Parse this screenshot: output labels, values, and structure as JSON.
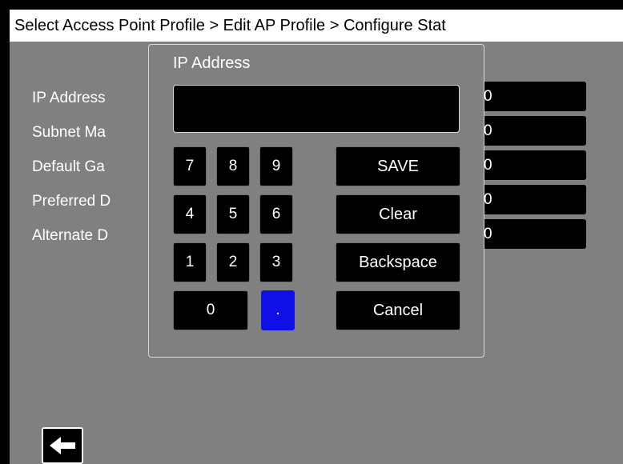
{
  "breadcrumb": "Select Access Point Profile > Edit AP Profile > Configure Stat",
  "fields": [
    {
      "label": "IP Address",
      "value": "0"
    },
    {
      "label": "Subnet Ma",
      "value": "0"
    },
    {
      "label": "Default Ga",
      "value": "0"
    },
    {
      "label": "Preferred D",
      "value": "0"
    },
    {
      "label": "Alternate D",
      "value": "0"
    }
  ],
  "dialog": {
    "title": "IP Address",
    "display_value": "",
    "keys": {
      "k7": "7",
      "k8": "8",
      "k9": "9",
      "k4": "4",
      "k5": "5",
      "k6": "6",
      "k1": "1",
      "k2": "2",
      "k3": "3",
      "k0": "0",
      "dot": "."
    },
    "actions": {
      "save": "SAVE",
      "clear": "Clear",
      "backspace": "Backspace",
      "cancel": "Cancel"
    }
  },
  "colors": {
    "background": "#808080",
    "field_bg": "#000000",
    "dot_key": "#1010e6",
    "text": "#ffffff"
  },
  "icons": {
    "back": "arrow-left-icon"
  }
}
